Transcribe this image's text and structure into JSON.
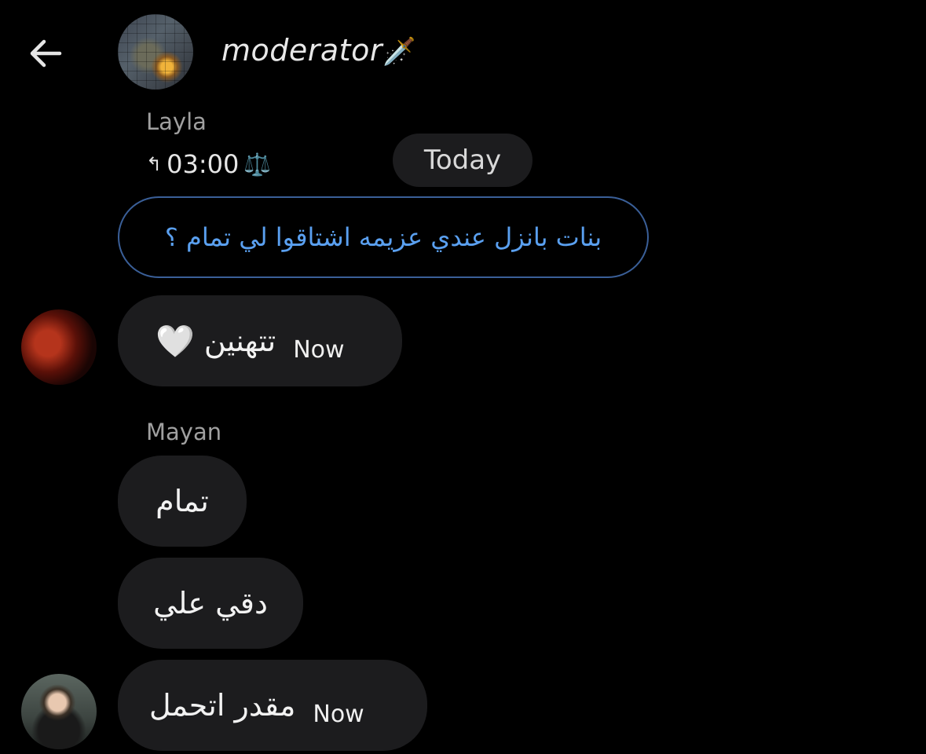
{
  "header": {
    "back_icon": "arrow-left-icon",
    "title": "moderator",
    "title_icon": "🗡️"
  },
  "messages": {
    "first_sender": "Layla",
    "reply_time": "03:00",
    "reply_emoji": "⚖️",
    "date_label": "Today",
    "quoted_text": "بنات بانزل عندي عزيمه اشتاقوا لي تمام ؟",
    "msg1_text": "تتهنين",
    "msg1_emoji": "🤍",
    "msg1_time": "Now",
    "second_sender": "Mayan",
    "msg2_text": "تمام",
    "msg3_text": "دقي علي",
    "msg4_text": "مقدر اتحمل",
    "msg4_time": "Now"
  },
  "colors": {
    "background": "#000000",
    "bubble": "#1c1c1e",
    "quote_border": "#3a5f98",
    "quote_text": "#5aa0f0",
    "secondary_text": "#a0a0a0"
  }
}
